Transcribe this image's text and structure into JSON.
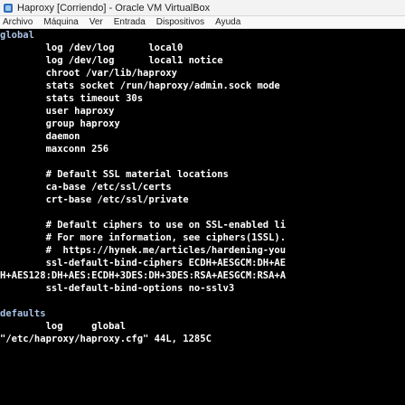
{
  "window": {
    "title": "Haproxy [Corriendo] - Oracle VM VirtualBox"
  },
  "menu": [
    "Archivo",
    "Máquina",
    "Ver",
    "Entrada",
    "Dispositivos",
    "Ayuda"
  ],
  "terminal": {
    "lines": [
      "global",
      "        log /dev/log      local0",
      "        log /dev/log      local1 notice",
      "        chroot /var/lib/haproxy",
      "        stats socket /run/haproxy/admin.sock mode",
      "        stats timeout 30s",
      "        user haproxy",
      "        group haproxy",
      "        daemon",
      "        maxconn 256",
      "",
      "        # Default SSL material locations",
      "        ca-base /etc/ssl/certs",
      "        crt-base /etc/ssl/private",
      "",
      "        # Default ciphers to use on SSL-enabled li",
      "        # For more information, see ciphers(1SSL).",
      "        #  https://hynek.me/articles/hardening-you",
      "        ssl-default-bind-ciphers ECDH+AESGCM:DH+AE",
      "H+AES128:DH+AES:ECDH+3DES:DH+3DES:RSA+AESGCM:RSA+A",
      "        ssl-default-bind-options no-sslv3",
      "",
      "defaults",
      "        log     global",
      "\"/etc/haproxy/haproxy.cfg\" 44L, 1285C"
    ]
  }
}
